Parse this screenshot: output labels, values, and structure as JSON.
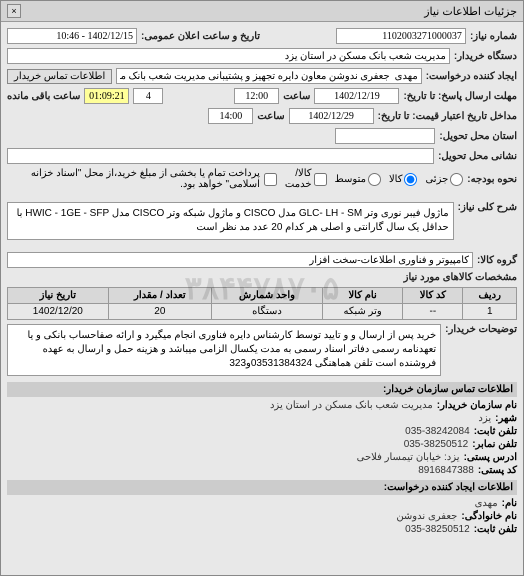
{
  "header": {
    "title": "جزئیات اطلاعات نیاز",
    "close": "×"
  },
  "form": {
    "request_number_label": "شماره نیاز:",
    "request_number": "1102003271000037",
    "public_date_label": "تاریخ و ساعت اعلان عمومی:",
    "public_date": "1402/12/15 - 10:46",
    "buyer_label": "دستگاه خریدار:",
    "buyer": "مدیریت شعب بانک مسکن در استان یزد",
    "requester_label": "ایجاد کننده درخواست:",
    "requester": "مهدی  جعفری ندوشن معاون دایره تجهیز و پشتیبانی مدیریت شعب بانک مسکن",
    "contact_btn": "اطلاعات تماس خریدار",
    "deadline_label": "مهلت ارسال پاسخ: تا تاریخ:",
    "deadline_date": "1402/12/19",
    "time_label": "ساعت",
    "deadline_time": "12:00",
    "remaining_count": "4",
    "remaining_time": "01:09:21",
    "remaining_label": "ساعت باقی مانده",
    "validity_label": "مداخل تاریخ اعتبار قیمت: تا تاریخ:",
    "validity_date": "1402/12/29",
    "validity_time": "14:00",
    "delivery_place_label": "استان محل تحویل:",
    "delivery_place": "",
    "delivery_address_label": "نشانی محل تحویل:",
    "delivery_address": "",
    "budget_type_label": "نحوه بودجه:",
    "budget_options": {
      "goods": "کالا",
      "partial": "جزئی",
      "medium": "متوسط",
      "installment": "کالا/خدمت"
    },
    "payment_note_label": "",
    "payment_note": "پرداخت تمام یا بخشی از مبلغ خرید،از محل \"اسناد خزانه اسلامی\" خواهد بود.",
    "description_label": "شرح کلی نیاز:",
    "description": "ماژول فیبر نوری وتر GLC- LH - SM مدل CISCO و ماژول شبکه وتر CISCO مدل HWIC - 1GE - SFP با حداقل یک سال گارانتی و اصلی هر کدام 20 عدد مد نظر است",
    "goods_group_label": "گروه کالا:",
    "goods_group": "کامپیوتر و فناوری اطلاعات-سخت افزار",
    "items_table_label": "مشخصات کالاهای مورد نیاز"
  },
  "table": {
    "headers": {
      "row": "ردیف",
      "code": "کد کالا",
      "name": "نام کالا",
      "unit": "واحد شمارش",
      "qty": "تعداد / مقدار",
      "date": "تاریخ نیاز"
    },
    "rows": [
      {
        "row": "1",
        "code": "--",
        "name": "وتر شبکه",
        "unit": "دستگاه",
        "qty": "20",
        "date": "1402/12/20"
      }
    ]
  },
  "buyer_notes": {
    "label": "توضیحات خریدار:",
    "text": "خرید پس از ارسال و و تایید توسط کارشناس دایره فناوری انجام میگیرد و ارائه صفاحساب بانکی و یا تعهدنامه رسمی دفاتر اسناد رسمی به مدت یکسال الزامی میباشد و هزینه حمل و ارسال به عهده فروشنده است تلفن هماهنگی 03531384324و323"
  },
  "contact": {
    "section_title": "اطلاعات تماس سازمان خریدار:",
    "org_label": "نام سازمان خریدار:",
    "org": "مدیریت شعب بانک مسکن در استان یزد",
    "city_label": "شهر:",
    "city": "یزد",
    "phone_label": "تلفن ثابت:",
    "phone": "035-38242084",
    "fax_label": "تلفن نمابر:",
    "fax": "035-38250512",
    "address_label": "ادرس پستی:",
    "address": "یزد: خیابان تیمسار فلاحی",
    "postal_label": "کد پستی:",
    "postal": "8916847388",
    "requester_section_title": "اطلاعات ایجاد کننده درخواست:",
    "name_label": "نام:",
    "name": "مهدی",
    "family_label": "نام خانوادگی:",
    "family": "جعفری ندوشن",
    "req_phone_label": "تلفن ثابت:",
    "req_phone": "035-38250512"
  },
  "watermark": "۳۸۴۴۷۸۷۰۵"
}
